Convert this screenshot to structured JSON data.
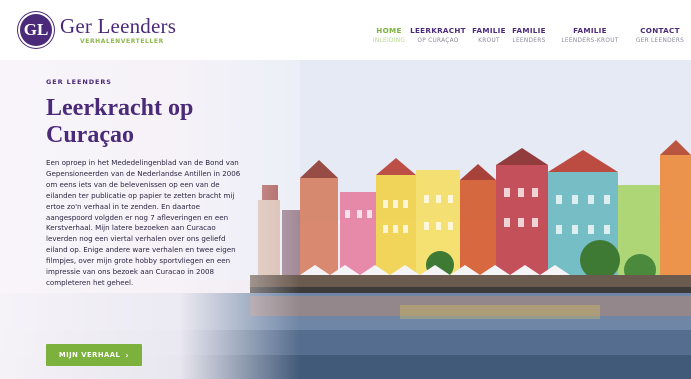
{
  "brand": {
    "logo_letters": "GL",
    "title": "Ger Leenders",
    "subtitle": "VERHALENVERTELLER"
  },
  "nav": {
    "items": [
      {
        "top": "HOME",
        "bottom": "INLEIDING",
        "active": true
      },
      {
        "top": "LEERKRACHT",
        "bottom": "OP CURAÇAO",
        "active": false
      },
      {
        "top": "FAMILIE",
        "bottom": "KROUT",
        "active": false
      },
      {
        "top": "FAMILIE",
        "bottom": "LEENDERS",
        "active": false
      },
      {
        "top": "FAMILIE",
        "bottom": "LEENDERS-KROUT",
        "active": false
      },
      {
        "top": "CONTACT",
        "bottom": "GER LEENDERS",
        "active": false
      }
    ]
  },
  "hero": {
    "eyebrow": "GER LEENDERS",
    "title": "Leerkracht op Curaçao",
    "body": "Een oproep in het Mededelingenblad van de Bond van Gepensioneerden van de Nederlandse Antillen in 2006 om eens iets van de belevenissen op een van de eilanden ter publicatie op papier te zetten bracht mij ertoe zo'n verhaal in te zenden. En daartoe aangespoord volgden er nog 7 afleveringen en een Kerstverhaal. Mijn latere bezoeken aan Curacao leverden nog een viertal verhalen over ons geliefd eiland op. Enige andere ware verhalen en twee eigen filmpjes, over mijn grote hobby sportvliegen en een impressie van ons bezoek aan Curacao in 2008 completeren het geheel.",
    "cta_label": "MIJN VERHAAL",
    "cta_chevron": "›"
  },
  "colors": {
    "brand_purple": "#4b2a79",
    "accent_green": "#7bb13c"
  }
}
